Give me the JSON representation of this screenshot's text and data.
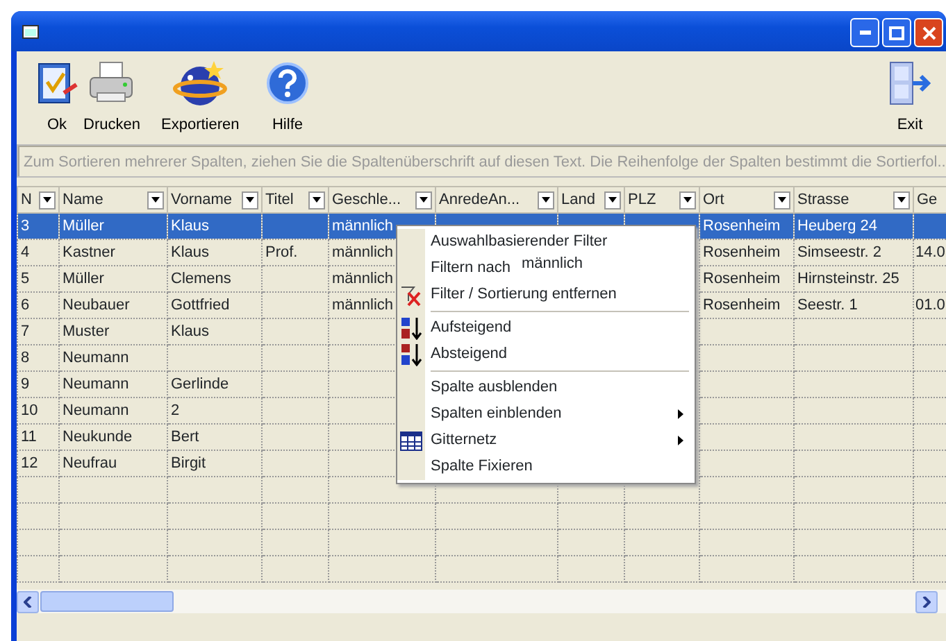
{
  "toolbar": [
    {
      "label": "Ok",
      "kind": "ok"
    },
    {
      "label": "Drucken",
      "kind": "print"
    },
    {
      "label": "Exportieren",
      "kind": "export"
    },
    {
      "label": "Hilfe",
      "kind": "help"
    },
    {
      "label": "Exit",
      "kind": "exit"
    }
  ],
  "group_bar": {
    "placeholder": "Zum Sortieren mehrerer Spalten, ziehen Sie die Spaltenüberschrift auf diesen Text. Die Reihenfolge der Spalten bestimmt die Sortierfol..."
  },
  "table": {
    "columns": [
      "N",
      "Name",
      "Vorname",
      "Titel",
      "Geschle...",
      "AnredeAn...",
      "Land",
      "PLZ",
      "Ort",
      "Strasse",
      "Ge"
    ],
    "rows": [
      {
        "selected": true,
        "cells": [
          "3",
          "Müller",
          "Klaus",
          "",
          "männlich",
          "",
          "",
          "",
          "Rosenheim",
          "Heuberg 24",
          ""
        ]
      },
      {
        "selected": false,
        "cells": [
          "4",
          "Kastner",
          "Klaus",
          "Prof.",
          "männlich",
          "",
          "",
          "",
          "Rosenheim",
          "Simseestr. 2",
          "14.0"
        ]
      },
      {
        "selected": false,
        "cells": [
          "5",
          "Müller",
          "Clemens",
          "",
          "männlich",
          "",
          "",
          "",
          "Rosenheim",
          "Hirnsteinstr. 25",
          ""
        ]
      },
      {
        "selected": false,
        "cells": [
          "6",
          "Neubauer",
          "Gottfried",
          "",
          "männlich",
          "",
          "",
          "",
          "Rosenheim",
          "Seestr. 1",
          "01.0"
        ]
      },
      {
        "selected": false,
        "cells": [
          "7",
          "Muster",
          "Klaus",
          "",
          "",
          "",
          "",
          "",
          "",
          "",
          ""
        ]
      },
      {
        "selected": false,
        "cells": [
          "8",
          "Neumann",
          "",
          "",
          "",
          "",
          "",
          "",
          "",
          "",
          ""
        ]
      },
      {
        "selected": false,
        "cells": [
          "9",
          "Neumann",
          "Gerlinde",
          "",
          "",
          "",
          "",
          "",
          "",
          "",
          ""
        ]
      },
      {
        "selected": false,
        "cells": [
          "10",
          "Neumann",
          "2",
          "",
          "",
          "",
          "",
          "",
          "",
          "",
          ""
        ]
      },
      {
        "selected": false,
        "cells": [
          "11",
          "Neukunde",
          "Bert",
          "",
          "",
          "",
          "",
          "",
          "",
          "",
          ""
        ]
      },
      {
        "selected": false,
        "cells": [
          "12",
          "Neufrau",
          "Birgit",
          "",
          "",
          "",
          "",
          "",
          "",
          "",
          ""
        ]
      }
    ]
  },
  "context_menu": [
    {
      "kind": "item",
      "label": "Auswahlbasierender Filter"
    },
    {
      "kind": "value",
      "label": "Filtern nach",
      "value": "männlich"
    },
    {
      "kind": "remove",
      "label": "Filter / Sortierung entfernen"
    },
    {
      "kind": "separator"
    },
    {
      "kind": "ascending",
      "label": "Aufsteigend"
    },
    {
      "kind": "descending",
      "label": "Absteigend"
    },
    {
      "kind": "separator"
    },
    {
      "kind": "item",
      "label": "Spalte ausblenden"
    },
    {
      "kind": "submenu",
      "label": "Spalten einblenden"
    },
    {
      "kind": "gridmenu",
      "label": "Gitternetz"
    },
    {
      "kind": "item",
      "label": "Spalte Fixieren"
    }
  ]
}
